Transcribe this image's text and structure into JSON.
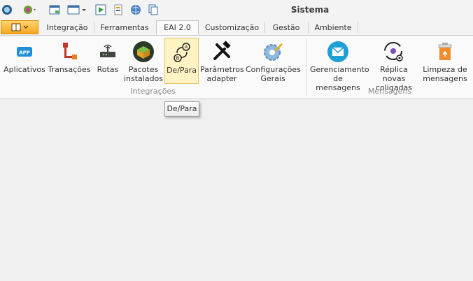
{
  "window": {
    "title": "Sistema"
  },
  "quick_access": [
    {
      "name": "app-orb-icon"
    },
    {
      "name": "settings-icon"
    },
    {
      "name": "window-icon"
    },
    {
      "name": "layout-icon"
    },
    {
      "name": "run-icon"
    },
    {
      "name": "document-icon"
    },
    {
      "name": "globe-icon"
    },
    {
      "name": "copy-icon"
    }
  ],
  "tabs": [
    {
      "label": "Integração",
      "active": false
    },
    {
      "label": "Ferramentas",
      "active": false
    },
    {
      "label": "EAI 2.0",
      "active": true
    },
    {
      "label": "Customização",
      "active": false
    },
    {
      "label": "Gestão",
      "active": false
    },
    {
      "label": "Ambiente",
      "active": false
    }
  ],
  "ribbon": {
    "groups": [
      {
        "label": "Integrações",
        "buttons": [
          {
            "label": "Aplicativos",
            "icon": "app-icon"
          },
          {
            "label": "Transações",
            "icon": "transactions-icon"
          },
          {
            "label": "Rotas",
            "icon": "router-icon"
          },
          {
            "label": "Pacotes instalados",
            "icon": "package-icon"
          },
          {
            "label": "De/Para",
            "icon": "mapping-icon",
            "highlighted": true
          },
          {
            "label": "Parâmetros adapter",
            "icon": "tools-icon"
          },
          {
            "label": "Configurações Gerais",
            "icon": "gear-icon"
          }
        ]
      },
      {
        "label": "Mensagens",
        "buttons": [
          {
            "label": "Gerenciamento de mensagens",
            "icon": "envelope-icon"
          },
          {
            "label": "Réplica novas coligadas",
            "icon": "replica-icon"
          },
          {
            "label": "Limpeza de mensagens",
            "icon": "recycle-bin-icon"
          }
        ]
      }
    ]
  },
  "tooltip": {
    "text": "De/Para"
  },
  "colors": {
    "file_button": "#f6a623",
    "highlight": "#fff3c4",
    "accent_blue": "#1e8fd6"
  }
}
